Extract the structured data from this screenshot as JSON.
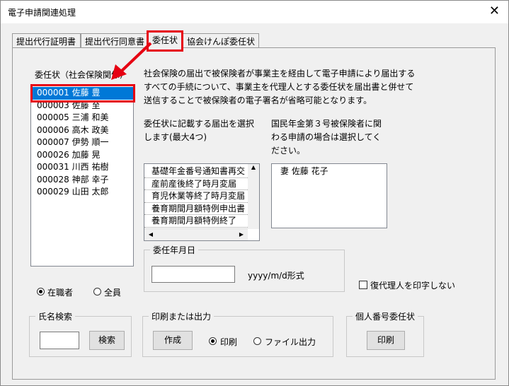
{
  "window": {
    "title": "電子申請関連処理",
    "close_glyph": "✕"
  },
  "tabs": [
    {
      "label": "提出代行証明書"
    },
    {
      "label": "提出代行同意書"
    },
    {
      "label": "委任状"
    },
    {
      "label": "協会けんぽ委任状"
    }
  ],
  "poa": {
    "label": "委任状（社会保険関係）",
    "employees": [
      {
        "text": "000001 佐藤 豊",
        "selected": true
      },
      {
        "text": "000003 佐藤 至"
      },
      {
        "text": "000005 三浦 和美"
      },
      {
        "text": "000006 高木 政美"
      },
      {
        "text": "000007 伊勢 順一"
      },
      {
        "text": "000026 加藤 晃"
      },
      {
        "text": "000031 川西 祐樹"
      },
      {
        "text": "000028 神部 幸子"
      },
      {
        "text": "000029 山田 太郎"
      }
    ]
  },
  "description": "社会保険の届出で被保険者が事業主を経由して電子申請により届出する\nすべての手続について、事業主を代理人とする委任状を届出書と併せて\n送信することで被保険者の電子署名が省略可能となります。",
  "forms": {
    "label": "委任状に記載する届出を選択\nします(最大4つ)",
    "items": [
      "基礎年金番号通知書再交",
      "産前産後終了時月変届",
      "育児休業等終了時月変届",
      "養育期間月額特例申出書",
      "養育期間月額特例終了"
    ]
  },
  "spouse": {
    "label": "国民年金第３号被保険者に関\nわる申請の場合は選択してく\nださい。",
    "items": [
      "妻 佐藤 花子"
    ]
  },
  "date": {
    "group_label": "委任年月日",
    "value": "",
    "format_hint": "yyyy/m/d形式"
  },
  "no_sub_agent_label": "復代理人を印字しない",
  "filter": {
    "employed_label": "在職者",
    "all_label": "全員"
  },
  "name_search": {
    "group_label": "氏名検索",
    "value": "",
    "button": "検索"
  },
  "print_output": {
    "group_label": "印刷または出力",
    "create_button": "作成",
    "print_label": "印刷",
    "file_label": "ファイル出力"
  },
  "mynumber": {
    "group_label": "個人番号委任状",
    "print_button": "印刷"
  },
  "colors": {
    "highlight": "#e60012",
    "selection": "#0078d7"
  }
}
